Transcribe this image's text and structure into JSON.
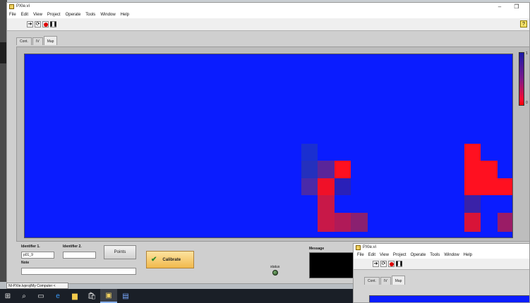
{
  "main_window": {
    "title": "PXIe.vi",
    "menu": [
      "File",
      "Edit",
      "View",
      "Project",
      "Operate",
      "Tools",
      "Window",
      "Help"
    ],
    "toolbar_icons": [
      "run-arrow-icon",
      "run-continuous-icon",
      "abort-icon",
      "pause-icon"
    ],
    "help_icon": "?"
  },
  "tabs": [
    {
      "label": "Cont."
    },
    {
      "label": "IV"
    },
    {
      "label": "Map",
      "active": true
    }
  ],
  "map": {
    "background": "#0a1cff",
    "scale_top_label": "1",
    "scale_bottom_label": "0"
  },
  "controls": {
    "identifier1_label": "Identifier 1.",
    "identifier1_value": "p01_9",
    "identifier2_label": "Identifier 2.",
    "identifier2_value": "",
    "note_label": "Note",
    "note_value": "",
    "points_button": "Points",
    "calibrate_button": "Calibrate",
    "message_label": "Message",
    "status_label": "status"
  },
  "second_window": {
    "title": "PXIe.vi",
    "menu": [
      "File",
      "Edit",
      "View",
      "Project",
      "Operate",
      "Tools",
      "Window",
      "Help"
    ],
    "tabs": [
      "Cont.",
      "IV",
      "Map"
    ]
  },
  "status_path": "NI-PXIe.lvproj/My Computer"
}
